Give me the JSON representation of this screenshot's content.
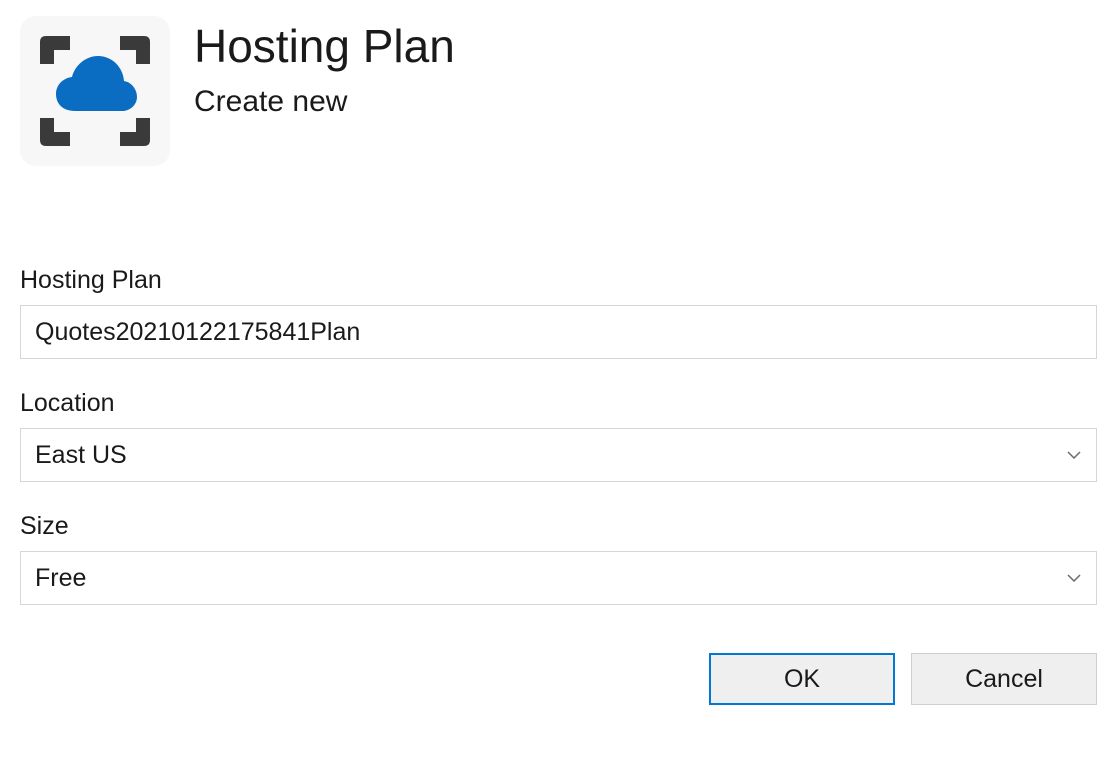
{
  "header": {
    "title": "Hosting Plan",
    "subtitle": "Create new"
  },
  "fields": {
    "hosting_plan": {
      "label": "Hosting Plan",
      "value": "Quotes20210122175841Plan"
    },
    "location": {
      "label": "Location",
      "value": "East US"
    },
    "size": {
      "label": "Size",
      "value": "Free"
    }
  },
  "buttons": {
    "ok": "OK",
    "cancel": "Cancel"
  }
}
